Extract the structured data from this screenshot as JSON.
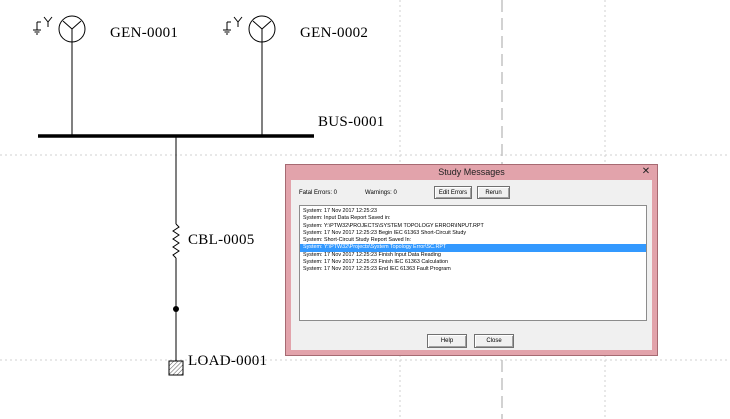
{
  "diagram": {
    "generators": [
      {
        "id": "GEN-0001"
      },
      {
        "id": "GEN-0002"
      }
    ],
    "bus": {
      "id": "BUS-0001"
    },
    "cable": {
      "id": "CBL-0005"
    },
    "load": {
      "id": "LOAD-0001"
    }
  },
  "dialog": {
    "title": "Study  Messages",
    "close_glyph": "✕",
    "fatal_errors_label": "Fatal Errors:  0",
    "warnings_label": "Warnings:  0",
    "edit_errors_label": "Edit Errors",
    "rerun_label": "Rerun",
    "help_label": "Help",
    "close_label": "Close",
    "selection_color": "#3399ff",
    "messages": [
      "System:  17 Nov 2017    12:25:23",
      "System:   Input Data Report Saved in:",
      "System:  Y:\\PTW32\\PROJECTS\\SYSTEM TOPOLOGY ERROR\\INPUT.RPT",
      "System:  17 Nov 2017    12:25:23 Begin IEC 61363 Short-Circuit Study",
      "System:   Short-Circuit Study Report Saved In:",
      "System:  Y:\\PTW32\\Projects\\System Topology Error\\SC.RPT",
      "System:  17 Nov 2017    12:25:23 Finish Input Data Reading",
      "System:  17 Nov 2017    12:25:23 Finish IEC 61363 Calculation",
      "System:  17 Nov 2017    12:25:23 End IEC 61363 Fault Program"
    ],
    "selected_index": 5
  }
}
